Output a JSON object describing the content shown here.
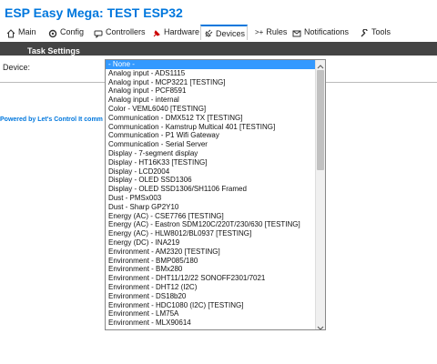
{
  "app": {
    "title": "ESP Easy Mega: TEST ESP32"
  },
  "tabs": [
    {
      "label": "Main",
      "icon": "home-icon"
    },
    {
      "label": "Config",
      "icon": "gear-icon"
    },
    {
      "label": "Controllers",
      "icon": "chat-icon"
    },
    {
      "label": "Hardware",
      "icon": "pin-icon"
    },
    {
      "label": "Devices",
      "icon": "plug-icon",
      "active": true
    },
    {
      "label": "Rules",
      "icon": "arrow-icon"
    },
    {
      "label": "Notifications",
      "icon": "envelope-icon"
    },
    {
      "label": "Tools",
      "icon": "wrench-icon"
    }
  ],
  "section": {
    "title": "Task Settings"
  },
  "device": {
    "label": "Device:"
  },
  "footer": {
    "prefix": "Powered by ",
    "link": "Let's Control It",
    "suffix": " comm"
  },
  "dropdown": {
    "selected": "- None -",
    "options": [
      "- None -",
      "Analog input - ADS1115",
      "Analog input - MCP3221 [TESTING]",
      "Analog input - PCF8591",
      "Analog input - internal",
      "Color - VEML6040 [TESTING]",
      "Communication - DMX512 TX [TESTING]",
      "Communication - Kamstrup Multical 401 [TESTING]",
      "Communication - P1 Wifi Gateway",
      "Communication - Serial Server",
      "Display - 7-segment display",
      "Display - HT16K33 [TESTING]",
      "Display - LCD2004",
      "Display - OLED SSD1306",
      "Display - OLED SSD1306/SH1106 Framed",
      "Dust - PMSx003",
      "Dust - Sharp GP2Y10",
      "Energy (AC) - CSE7766 [TESTING]",
      "Energy (AC) - Eastron SDM120C/220T/230/630 [TESTING]",
      "Energy (AC) - HLW8012/BL0937 [TESTING]",
      "Energy (DC) - INA219",
      "Environment - AM2320 [TESTING]",
      "Environment - BMP085/180",
      "Environment - BMx280",
      "Environment - DHT11/12/22 SONOFF2301/7021",
      "Environment - DHT12 (I2C)",
      "Environment - DS18b20",
      "Environment - HDC1080 (I2C) [TESTING]",
      "Environment - LM75A",
      "Environment - MLX90614"
    ],
    "scroll_fraction": 0.0
  },
  "colors": {
    "accent": "#0077dd",
    "bar": "#444444",
    "highlight": "#3399ff"
  }
}
